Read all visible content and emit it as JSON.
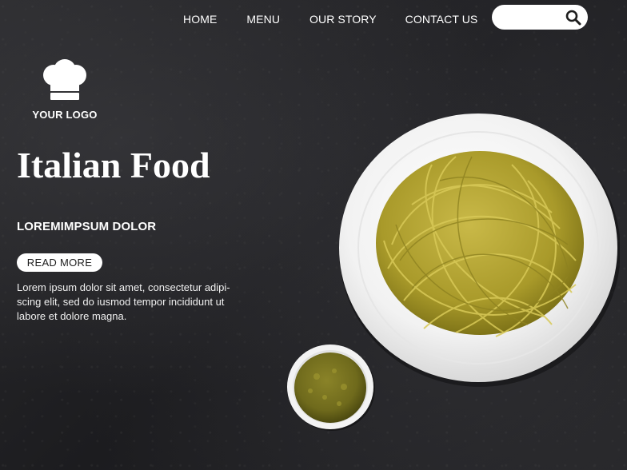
{
  "nav": {
    "items": [
      {
        "label": "HOME"
      },
      {
        "label": "MENU"
      },
      {
        "label": "OUR STORY"
      },
      {
        "label": "CONTACT US"
      }
    ]
  },
  "search": {
    "placeholder": "",
    "icon": "search-icon"
  },
  "logo": {
    "icon": "chef-hat-icon",
    "text": "YOUR LOGO"
  },
  "hero": {
    "title": "Italian Food",
    "subtitle": "LOREMIMPSUM DOLOR",
    "button_label": "READ MORE",
    "description": "Lorem ipsum dolor sit amet, consectetur adipi-scing elit, sed do iusmod tempor incididunt ut labore et dolore magna."
  },
  "colors": {
    "background": "#232326",
    "text": "#ffffff",
    "button_bg": "#ffffff",
    "button_text": "#1e1e1e",
    "pasta": "#b8a632",
    "pesto": "#6f6a1c"
  }
}
